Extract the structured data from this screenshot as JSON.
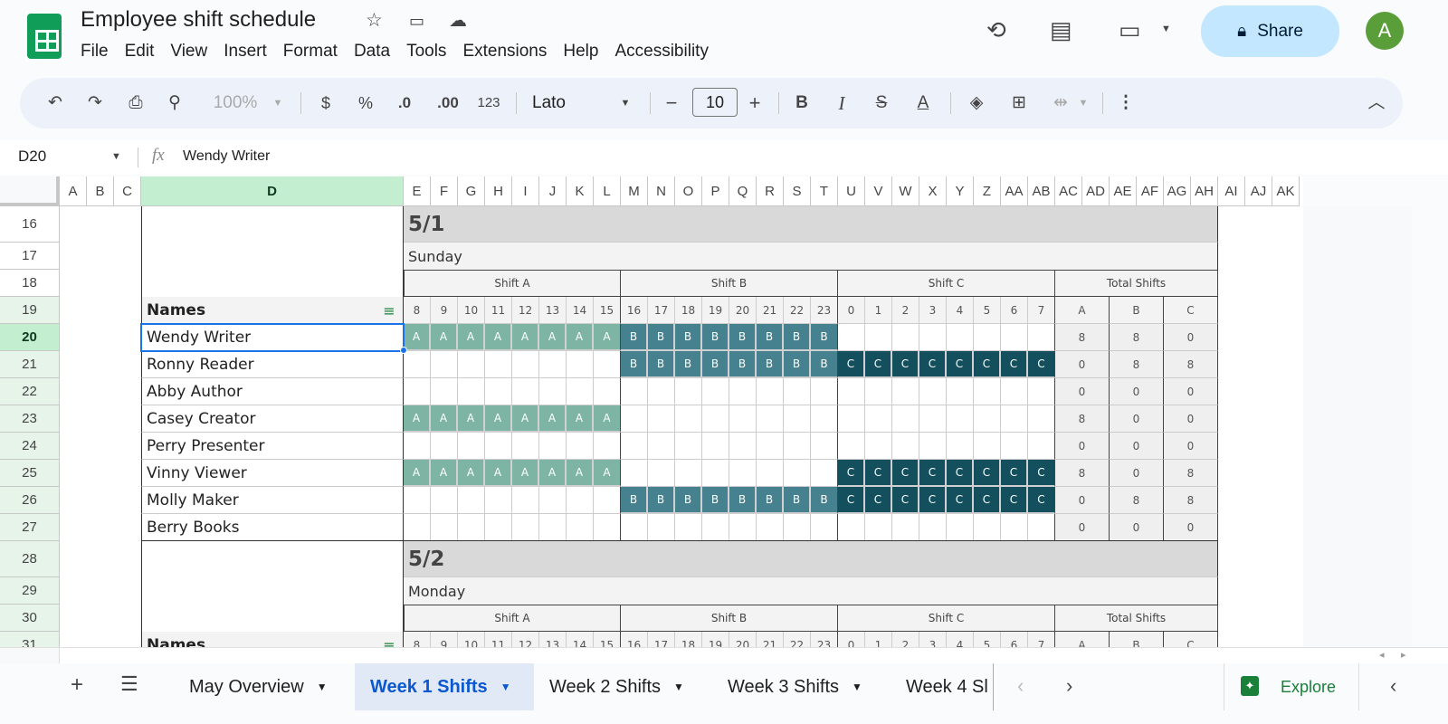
{
  "app": {
    "title": "Employee shift schedule",
    "share_label": "Share",
    "avatar_letter": "A"
  },
  "menu": [
    "File",
    "Edit",
    "View",
    "Insert",
    "Format",
    "Data",
    "Tools",
    "Extensions",
    "Help",
    "Accessibility"
  ],
  "toolbar": {
    "zoom": "100%",
    "currency": "$",
    "percent": "%",
    "dec_decrease": ".0",
    "dec_increase": ".00",
    "number_format": "123",
    "font": "Lato",
    "font_size": "10",
    "bold": "B",
    "italic": "I"
  },
  "formula_bar": {
    "cell_ref": "D20",
    "fx": "fx",
    "value": "Wendy Writer"
  },
  "columns": [
    "A",
    "B",
    "C",
    "D",
    "E",
    "F",
    "G",
    "H",
    "I",
    "J",
    "K",
    "L",
    "M",
    "N",
    "O",
    "P",
    "Q",
    "R",
    "S",
    "T",
    "U",
    "V",
    "W",
    "X",
    "Y",
    "Z",
    "AA",
    "AB",
    "AC",
    "AD",
    "AE",
    "AF",
    "AG",
    "AH",
    "AI",
    "AJ",
    "AK"
  ],
  "rows": [
    "16",
    "17",
    "18",
    "19",
    "20",
    "21",
    "22",
    "23",
    "24",
    "25",
    "26",
    "27",
    "28",
    "29",
    "30",
    "31"
  ],
  "selected": {
    "column": "D",
    "row": "20"
  },
  "colors": {
    "shift_a": "#7eb4a3",
    "shift_b": "#45818e",
    "shift_c": "#134f5c",
    "accent": "#0b57d0"
  },
  "shift_headers": [
    "Shift A",
    "Shift B",
    "Shift C",
    "Total Shifts"
  ],
  "hours": [
    "8",
    "9",
    "10",
    "11",
    "12",
    "13",
    "14",
    "15",
    "16",
    "17",
    "18",
    "19",
    "20",
    "21",
    "22",
    "23",
    "0",
    "1",
    "2",
    "3",
    "4",
    "5",
    "6",
    "7"
  ],
  "total_headers": [
    "A",
    "B",
    "C"
  ],
  "names_header": "Names",
  "days": [
    {
      "date": "5/1",
      "weekday": "Sunday",
      "employees": [
        {
          "name": "Wendy Writer",
          "shifts": [
            "A",
            "B",
            ""
          ],
          "totals": [
            "8",
            "8",
            "0"
          ]
        },
        {
          "name": "Ronny Reader",
          "shifts": [
            "",
            "B",
            "C"
          ],
          "totals": [
            "0",
            "8",
            "8"
          ]
        },
        {
          "name": "Abby Author",
          "shifts": [
            "",
            "",
            ""
          ],
          "totals": [
            "0",
            "0",
            "0"
          ]
        },
        {
          "name": "Casey Creator",
          "shifts": [
            "A",
            "",
            ""
          ],
          "totals": [
            "8",
            "0",
            "0"
          ]
        },
        {
          "name": "Perry Presenter",
          "shifts": [
            "",
            "",
            ""
          ],
          "totals": [
            "0",
            "0",
            "0"
          ]
        },
        {
          "name": "Vinny Viewer",
          "shifts": [
            "A",
            "",
            "C"
          ],
          "totals": [
            "8",
            "0",
            "8"
          ]
        },
        {
          "name": "Molly Maker",
          "shifts": [
            "",
            "B",
            "C"
          ],
          "totals": [
            "0",
            "8",
            "8"
          ]
        },
        {
          "name": "Berry Books",
          "shifts": [
            "",
            "",
            ""
          ],
          "totals": [
            "0",
            "0",
            "0"
          ]
        }
      ]
    },
    {
      "date": "5/2",
      "weekday": "Monday",
      "employees": []
    }
  ],
  "sheet_tabs": [
    {
      "label": "May Overview",
      "active": false
    },
    {
      "label": "Week 1 Shifts",
      "active": true
    },
    {
      "label": "Week 2 Shifts",
      "active": false
    },
    {
      "label": "Week 3 Shifts",
      "active": false
    },
    {
      "label": "Week 4 Sl",
      "active": false
    }
  ],
  "explore_label": "Explore"
}
